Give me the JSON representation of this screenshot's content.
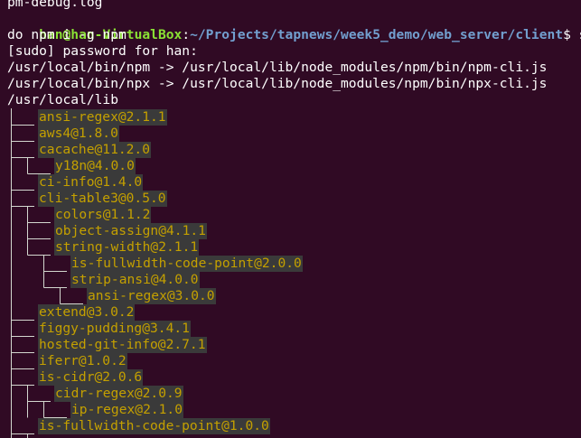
{
  "terminal": {
    "lines": [
      "pm-debug.log",
      "",
      "do npm i -g npm",
      "[sudo] password for han:",
      "/usr/local/bin/npm -> /usr/local/lib/node_modules/npm/bin/npm-cli.js",
      "/usr/local/bin/npx -> /usr/local/lib/node_modules/npm/bin/npx-cli.js",
      "/usr/local/lib"
    ],
    "prompt": {
      "user_host": "han@han-VirtualBox",
      "sep": ":",
      "path": "~/Projects/tapnews/week5_demo/web_server/client",
      "symbol": "$ su"
    },
    "packages": [
      "ansi-regex@2.1.1",
      "aws4@1.8.0",
      "cacache@11.2.0",
      "y18n@4.0.0",
      "ci-info@1.4.0",
      "cli-table3@0.5.0",
      "colors@1.1.2",
      "object-assign@4.1.1",
      "string-width@2.1.1",
      "is-fullwidth-code-point@2.0.0",
      "strip-ansi@4.0.0",
      "ansi-regex@3.0.0",
      "extend@3.0.2",
      "figgy-pudding@3.4.1",
      "hosted-git-info@2.7.1",
      "iferr@1.0.2",
      "is-cidr@2.0.6",
      "cidr-regex@2.0.9",
      "ip-regex@2.1.0",
      "is-fullwidth-code-point@1.0.0"
    ]
  }
}
